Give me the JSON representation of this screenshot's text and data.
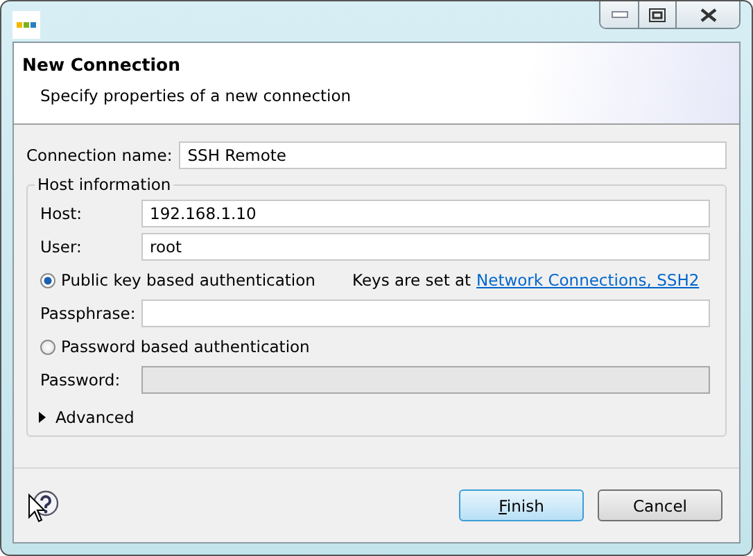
{
  "header": {
    "title": "New Connection",
    "description": "Specify properties of a new connection"
  },
  "connection_name": {
    "label": "Connection name:",
    "value": "SSH Remote"
  },
  "host_group": {
    "title": "Host information",
    "host": {
      "label": "Host:",
      "value": "192.168.1.10"
    },
    "user": {
      "label": "User:",
      "value": "root"
    },
    "auth_options": [
      {
        "label": "Public key based authentication",
        "selected": true,
        "note": "Keys are set at",
        "link": "Network Connections, SSH2",
        "field": {
          "label": "Passphrase:",
          "disabled": false
        }
      },
      {
        "label": "Password based authentication",
        "selected": false,
        "field": {
          "label": "Password:",
          "disabled": true
        }
      }
    ]
  },
  "advanced": {
    "label": "Advanced",
    "expanded": false
  },
  "buttons": [
    {
      "label": "Finish",
      "default": true
    },
    {
      "label": "Cancel",
      "default": false
    }
  ]
}
